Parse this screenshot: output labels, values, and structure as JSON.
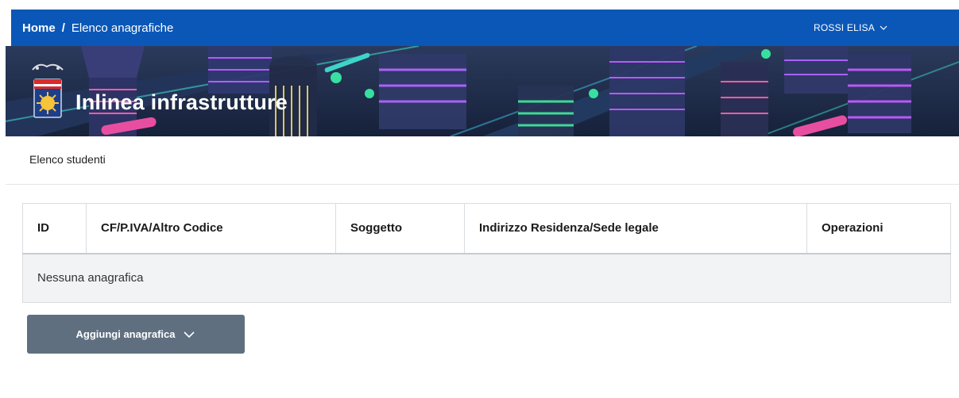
{
  "breadcrumb": {
    "home": "Home",
    "separator": "/",
    "current": "Elenco anagrafiche"
  },
  "user": {
    "name": "ROSSI ELISA",
    "icon": "chevron-down-icon"
  },
  "hero": {
    "title": "Inlinea infrastrutture",
    "logo": "coat-of-arms-icon"
  },
  "section": {
    "title": "Elenco studenti"
  },
  "table": {
    "headers": [
      "ID",
      "CF/P.IVA/Altro Codice",
      "Soggetto",
      "Indirizzo Residenza/Sede legale",
      "Operazioni"
    ],
    "empty_message": "Nessuna anagrafica"
  },
  "actions": {
    "add_label": "Aggiungi anagrafica",
    "add_icon": "chevron-down-icon"
  },
  "colors": {
    "topbar": "#0b57b7",
    "button": "#5f6f80",
    "table_empty_bg": "#f2f3f5"
  }
}
